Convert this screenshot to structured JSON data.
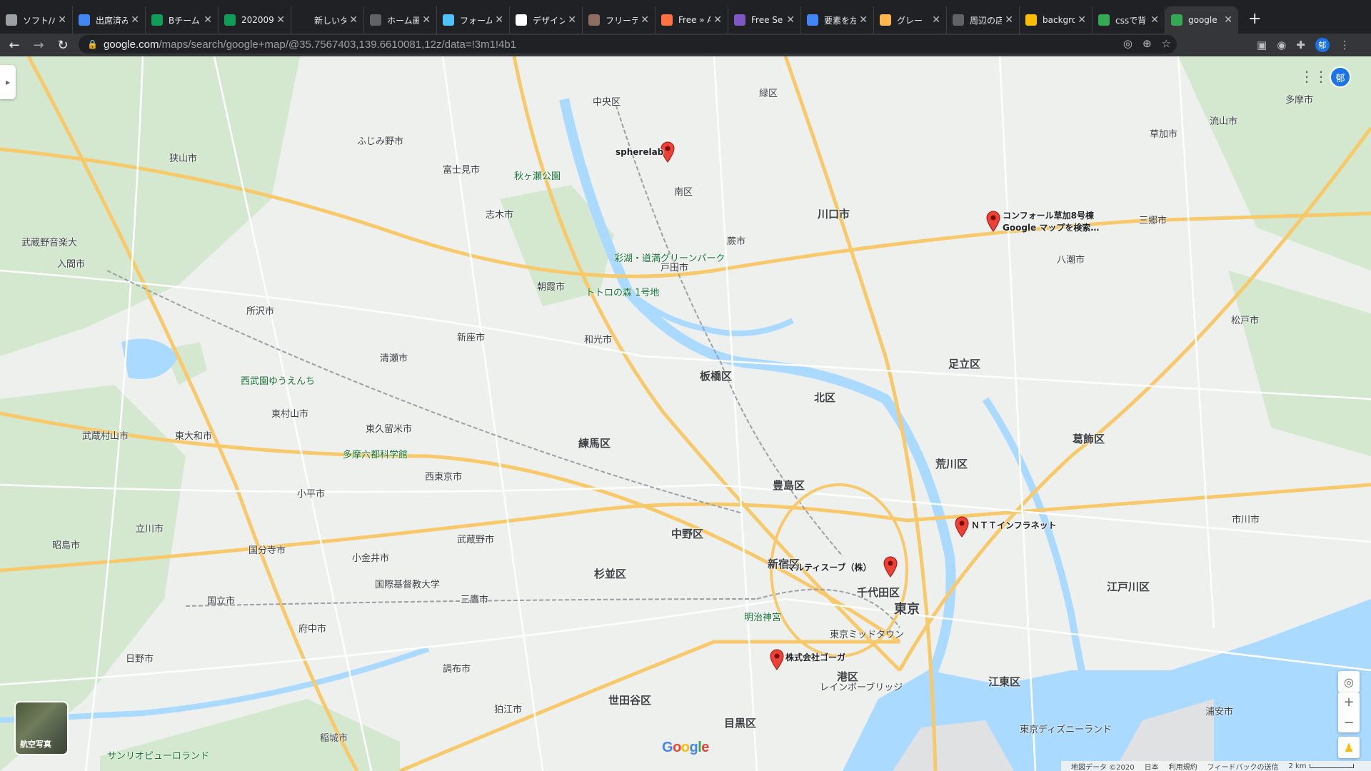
{
  "tabs": [
    {
      "title": "ソフト/バ",
      "color": "#9aa0a6"
    },
    {
      "title": "出席済み",
      "color": "#4285f4"
    },
    {
      "title": "Bチーム",
      "color": "#0f9d58"
    },
    {
      "title": "2020091",
      "color": "#0f9d58"
    },
    {
      "title": "新しいタブ",
      "color": "#202124"
    },
    {
      "title": "ホーム画",
      "color": "#5f6368"
    },
    {
      "title": "フォーム",
      "color": "#4fc3f7"
    },
    {
      "title": "デザイン",
      "color": "#ffffff"
    },
    {
      "title": "フリーテ",
      "color": "#8d6e63"
    },
    {
      "title": "Free » A",
      "color": "#ff7043"
    },
    {
      "title": "Free Se",
      "color": "#7e57c2"
    },
    {
      "title": "要素を左",
      "color": "#4285f4"
    },
    {
      "title": "グレー",
      "color": "#ffb74d"
    },
    {
      "title": "周辺の店",
      "color": "#5f6368"
    },
    {
      "title": "backgro",
      "color": "#fbbc04"
    },
    {
      "title": "cssで背",
      "color": "#34a853"
    },
    {
      "title": "google",
      "color": "#34a853",
      "active": true
    }
  ],
  "omnibox": {
    "host": "google.com",
    "path": "/maps/search/google+map/@35.7567403,139.6610081,12z/data=!3m1!4b1"
  },
  "profile_initial": "郁",
  "map": {
    "wards_big": [
      {
        "name": "東京"
      }
    ],
    "markers": [
      {
        "label": "spherelab"
      },
      {
        "label": "コンフォール草加8号棟\nGoogle マップを検索…"
      },
      {
        "label": "ＮＴＴインフラネット"
      },
      {
        "label": "マルティスーブ（株）"
      },
      {
        "label": "株式会社ゴーガ"
      }
    ],
    "labels": [
      "川口市",
      "蕨市",
      "戸田市",
      "朝霞市",
      "和光市",
      "板橋区",
      "北区",
      "足立区",
      "荒川区",
      "葛飾区",
      "練馬区",
      "豊島区",
      "新宿区",
      "中野区",
      "杉並区",
      "千代田区",
      "江戸川区",
      "江東区",
      "港区",
      "目黒区",
      "世田谷区",
      "調布市",
      "狛江市",
      "三鷹市",
      "武蔵野市",
      "西東京市",
      "小平市",
      "国分寺市",
      "小金井市",
      "府中市",
      "国立市",
      "立川市",
      "昭島市",
      "日野市",
      "東村山市",
      "東久留米市",
      "清瀬市",
      "新座市",
      "所沢市",
      "入間市",
      "狭山市",
      "ふじみ野市",
      "富士見市",
      "志木市",
      "南区",
      "緑区",
      "中央区",
      "草加市",
      "八潮市",
      "三郷市",
      "松戸市",
      "市川市",
      "流山市",
      "東大和市",
      "武蔵村山市",
      "多摩市",
      "稲城市",
      "浦安市",
      "トトロの森 1号地",
      "多摩六都科学館",
      "明治神宮",
      "東京ミッドタウン",
      "レインボーブリッジ",
      "東京ディズニーランド",
      "サンリオピューロランド",
      "西武園ゆうえんち",
      "秋ヶ瀬公園",
      "彩湖・道満グリーンパーク",
      "国際基督教大学",
      "武蔵野音楽大"
    ],
    "footer": {
      "data": "地図データ ©2020",
      "region": "日本",
      "terms": "利用規約",
      "feedback": "フィードバックの送信",
      "scale": "2 km"
    },
    "satellite_label": "航空写真",
    "logo": "Google"
  }
}
